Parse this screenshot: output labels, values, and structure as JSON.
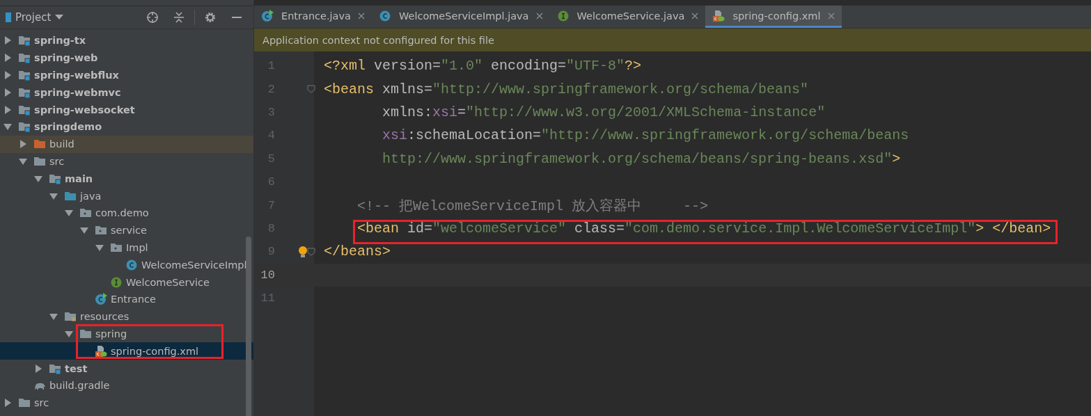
{
  "project_panel": {
    "title": "Project",
    "tree": [
      {
        "label": "spring-tx",
        "kind": "module",
        "expanded": false,
        "selected": false
      },
      {
        "label": "spring-web",
        "kind": "module",
        "expanded": false,
        "selected": false
      },
      {
        "label": "spring-webflux",
        "kind": "module",
        "expanded": false,
        "selected": false
      },
      {
        "label": "spring-webmvc",
        "kind": "module",
        "expanded": false,
        "selected": false
      },
      {
        "label": "spring-websocket",
        "kind": "module",
        "expanded": false,
        "selected": false
      },
      {
        "label": "springdemo",
        "kind": "module",
        "expanded": true,
        "selected": false,
        "children": [
          {
            "label": "build",
            "kind": "excluded-folder",
            "expanded": false,
            "selected": false,
            "highlighted": true
          },
          {
            "label": "src",
            "kind": "folder",
            "expanded": true,
            "selected": false,
            "children": [
              {
                "label": "main",
                "kind": "module",
                "expanded": true,
                "selected": false,
                "children": [
                  {
                    "label": "java",
                    "kind": "source",
                    "expanded": true,
                    "selected": false,
                    "children": [
                      {
                        "label": "com.demo",
                        "kind": "package",
                        "expanded": true,
                        "selected": false,
                        "children": [
                          {
                            "label": "service",
                            "kind": "package",
                            "expanded": true,
                            "selected": false,
                            "children": [
                              {
                                "label": "Impl",
                                "kind": "package",
                                "expanded": true,
                                "selected": false,
                                "children": [
                                  {
                                    "label": "WelcomeServiceImpl",
                                    "kind": "class",
                                    "selected": false
                                  }
                                ]
                              },
                              {
                                "label": "WelcomeService",
                                "kind": "interface",
                                "selected": false
                              }
                            ]
                          },
                          {
                            "label": "Entrance",
                            "kind": "main-class",
                            "selected": false
                          }
                        ]
                      }
                    ]
                  },
                  {
                    "label": "resources",
                    "kind": "resources",
                    "expanded": true,
                    "selected": false,
                    "children": [
                      {
                        "label": "spring",
                        "kind": "folder",
                        "expanded": true,
                        "selected": false,
                        "boxed": true,
                        "children": [
                          {
                            "label": "spring-config.xml",
                            "kind": "xml",
                            "selected": true
                          }
                        ]
                      }
                    ]
                  }
                ]
              },
              {
                "label": "test",
                "kind": "module",
                "expanded": false,
                "selected": false
              }
            ]
          },
          {
            "label": "build.gradle",
            "kind": "gradle",
            "selected": false
          }
        ]
      },
      {
        "label": "src",
        "kind": "folder",
        "expanded": false,
        "selected": false
      }
    ]
  },
  "tabs": [
    {
      "label": "Entrance.java",
      "kind": "main-class",
      "selected": false
    },
    {
      "label": "WelcomeServiceImpl.java",
      "kind": "class",
      "selected": false
    },
    {
      "label": "WelcomeService.java",
      "kind": "interface",
      "selected": false
    },
    {
      "label": "spring-config.xml",
      "kind": "xml",
      "selected": true
    }
  ],
  "notification": "Application context not configured for this file",
  "editor": {
    "lines": [
      {
        "number": "1",
        "current": false,
        "tokens": [
          {
            "kind": "tag",
            "text": "<?xml"
          },
          {
            "kind": "attr",
            "text": " version="
          },
          {
            "kind": "value",
            "text": "\"1.0\""
          },
          {
            "kind": "attr",
            "text": " encoding="
          },
          {
            "kind": "value",
            "text": "\"UTF-8\""
          },
          {
            "kind": "tag",
            "text": "?>"
          }
        ]
      },
      {
        "number": "2",
        "current": false,
        "fold": true,
        "tokens": [
          {
            "kind": "tag",
            "text": "<beans"
          },
          {
            "kind": "attr",
            "text": " xmlns="
          },
          {
            "kind": "value",
            "text": "\"http://www.springframework.org/schema/beans\""
          }
        ]
      },
      {
        "number": "3",
        "current": false,
        "tokens": [
          {
            "kind": "attr",
            "text": "       xmlns:"
          },
          {
            "kind": "ns",
            "text": "xsi"
          },
          {
            "kind": "attr",
            "text": "="
          },
          {
            "kind": "value",
            "text": "\"http://www.w3.org/2001/XMLSchema-instance\""
          }
        ]
      },
      {
        "number": "4",
        "current": false,
        "tokens": [
          {
            "kind": "ns",
            "text": "       xsi"
          },
          {
            "kind": "attr",
            "text": ":schemaLocation="
          },
          {
            "kind": "value",
            "text": "\"http://www.springframework.org/schema/beans"
          }
        ]
      },
      {
        "number": "5",
        "current": false,
        "tokens": [
          {
            "kind": "value",
            "text": "       http://www.springframework.org/schema/beans/spring-beans.xsd\""
          },
          {
            "kind": "tag",
            "text": ">"
          }
        ]
      },
      {
        "number": "6",
        "current": false
      },
      {
        "number": "7",
        "current": false,
        "tokens": [
          {
            "kind": "comment",
            "text": "    <!-- 把WelcomeServiceImpl 放入容器中     -->"
          }
        ]
      },
      {
        "number": "8",
        "current": false,
        "boxed": true,
        "tokens": [
          {
            "kind": "tag",
            "text": "    <bean"
          },
          {
            "kind": "attr",
            "text": " id="
          },
          {
            "kind": "value",
            "text": "\"welcomeService\""
          },
          {
            "kind": "attr",
            "text": " class="
          },
          {
            "kind": "value",
            "text": "\"com.demo.service.Impl.WelcomeServiceImpl\""
          },
          {
            "kind": "tag",
            "text": "> </bean>"
          }
        ]
      },
      {
        "number": "9",
        "current": false,
        "fold": true,
        "bulb": true,
        "tokens": [
          {
            "kind": "tag",
            "text": "</beans>"
          }
        ]
      },
      {
        "number": "10",
        "current": true
      },
      {
        "number": "11",
        "current": false
      }
    ]
  }
}
